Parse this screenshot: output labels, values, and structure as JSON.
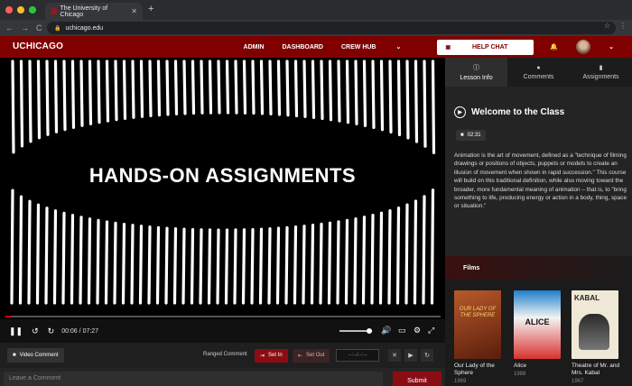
{
  "browser": {
    "tab_title": "The University of Chicago",
    "tab_close": "✕",
    "new_tab": "+",
    "url": "uchicago.edu",
    "nav": [
      "←",
      "→",
      "C"
    ],
    "dot_colors": [
      "#ff5f57",
      "#febc2e",
      "#28c840"
    ]
  },
  "header": {
    "logo": "UCHICAGO",
    "nav": [
      "ADMIN",
      "DASHBOARD",
      "CREW HUB"
    ],
    "crew_caret": "⌄",
    "help_label": "HELP CHAT",
    "accent": "#800000"
  },
  "video": {
    "overlay_title": "HANDS-ON ASSIGNMENTS",
    "current_time": "00:06",
    "duration": "07:27",
    "progress": 0.0134
  },
  "comment_bar": {
    "video_comment": "Video Comment",
    "ranged_comment": "Ranged Comment",
    "set_in": "Set In",
    "set_out": "Set Out",
    "time_placeholder": "--:--/--:--",
    "leave_placeholder": "Leave a Comment",
    "submit": "Submit"
  },
  "panel": {
    "tabs": [
      {
        "label": "Lesson Info",
        "icon": "info-icon"
      },
      {
        "label": "Comments",
        "icon": "comment-icon"
      },
      {
        "label": "Assignments",
        "icon": "book-icon"
      }
    ],
    "lesson_title": "Welcome to the Class",
    "duration": "02:31",
    "description": "Animation is the art of movement, defined as a \"technique of filming drawings or positions of objects, puppets or models to create an illusion of movement when shown in rapid succession.\" This course will build on this traditional definition, while also moving toward the broader, more fundamental meaning of animation – that is, to \"bring something to life, producing energy or action in a body, thing, space or situation.\"",
    "films_heading": "Films",
    "films": [
      {
        "title": "Our Lady of the Sphere",
        "year": "1969",
        "poster_text": "OUR LADY OF THE SPHERE"
      },
      {
        "title": "Alice",
        "year": "1988",
        "poster_text": "ALICE"
      },
      {
        "title": "Theatre of Mr. and Mrs. Kabal",
        "year": "1967",
        "poster_text": "KABAL"
      }
    ]
  }
}
